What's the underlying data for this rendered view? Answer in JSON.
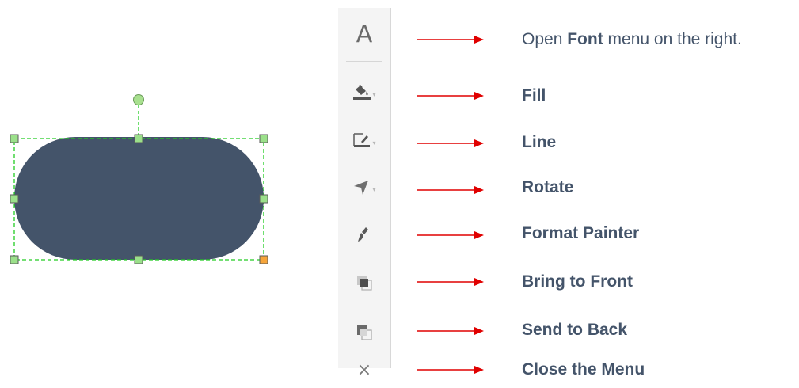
{
  "shape": {
    "fill": "#44546a",
    "selection_color": "#22cc22",
    "handle_color": "#9be08a",
    "corner_handle_orange": "#f6a53a",
    "rotate_handle_color": "#a8e08f"
  },
  "toolbar": {
    "items": [
      {
        "icon": "font-icon",
        "glyph": "A"
      },
      {
        "icon": "fill-bucket-icon"
      },
      {
        "icon": "line-pen-icon"
      },
      {
        "icon": "rotate-arrow-icon"
      },
      {
        "icon": "format-painter-brush-icon"
      },
      {
        "icon": "bring-to-front-icon"
      },
      {
        "icon": "send-to-back-icon"
      },
      {
        "icon": "close-icon",
        "glyph": "×"
      }
    ],
    "dropdown_caret": "▾"
  },
  "arrow_color": "#e00000",
  "labels": {
    "font": {
      "prefix": "Open",
      "bold": "Font",
      "suffix": "menu on the right."
    },
    "fill": "Fill",
    "line": "Line",
    "rotate": "Rotate",
    "format_painter": "Format Painter",
    "bring_to_front": "Bring to Front",
    "send_to_back": "Send to Back",
    "close_menu": "Close the Menu"
  }
}
